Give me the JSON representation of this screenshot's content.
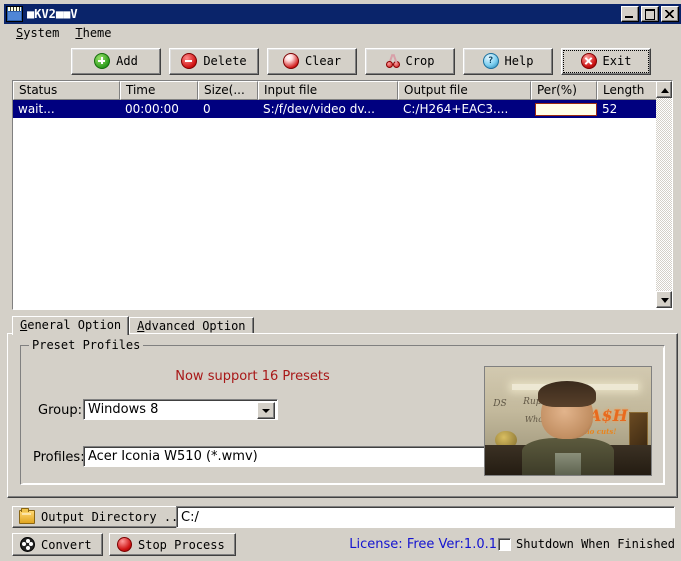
{
  "window": {
    "title": "■KV2■■V",
    "buttons": {
      "minimize": "minimize-icon",
      "maximize": "maximize-icon",
      "close": "close-icon"
    }
  },
  "menubar": {
    "items": [
      {
        "label": "System",
        "accel": "S"
      },
      {
        "label": "Theme",
        "accel": "T"
      }
    ]
  },
  "toolbar": {
    "buttons": [
      {
        "label": "Add",
        "icon": "add-icon"
      },
      {
        "label": "Delete",
        "icon": "delete-icon"
      },
      {
        "label": "Clear",
        "icon": "clear-icon"
      },
      {
        "label": "Crop",
        "icon": "scissors-icon"
      },
      {
        "label": "Help",
        "icon": "help-icon"
      },
      {
        "label": "Exit",
        "icon": "exit-icon"
      }
    ]
  },
  "filelist": {
    "columns": [
      "Status",
      "Time",
      "Size(...",
      "Input file",
      "Output file",
      "Per(%)",
      "Length"
    ],
    "rows": [
      {
        "status": "wait...",
        "time": "00:00:00",
        "size": "0",
        "input_file": "S:/f/dev/video dv...",
        "output_file": "C:/H264+EAC3....",
        "percent": "",
        "length": "52",
        "selected": true
      }
    ],
    "selection_color": "#00007f"
  },
  "tabs": [
    {
      "label": "General Option",
      "accel": "G",
      "active": true
    },
    {
      "label": "Advanced Option",
      "accel": "A",
      "active": false
    }
  ],
  "general_option": {
    "groupbox_title": "Preset Profiles",
    "notice": "Now support 16 Presets",
    "notice_color": "#a81818",
    "group_label": "Group:",
    "group_value": "Windows 8",
    "profiles_label": "Profiles:",
    "profiles_value": "Acer Iconia W510 (*.wmv)",
    "preview": {
      "alt": "video-thumbnail",
      "sign_text_1": "DS",
      "sign_text_2": "Rupkya",
      "sign_text_3": "Wholesale F",
      "sign_text_4": "CA$H",
      "sign_text_5": "no cuts!"
    }
  },
  "output": {
    "button_label": "Output Directory ...",
    "button_icon": "folder-icon",
    "path_value": "C:/",
    "path_placeholder": ""
  },
  "bottom": {
    "convert_label": "Convert",
    "convert_icon": "film-reel-icon",
    "stop_label": "Stop Process",
    "stop_icon": "stop-icon",
    "license": "License: Free Ver:1.0.1",
    "license_color": "#1414d0",
    "shutdown_label": "Shutdown When Finished",
    "shutdown_checked": false
  }
}
